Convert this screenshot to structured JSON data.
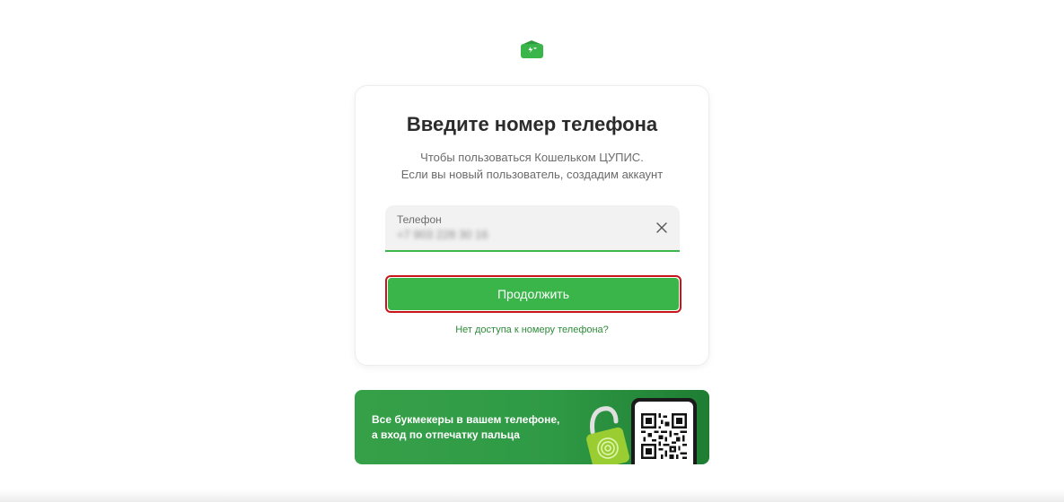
{
  "card": {
    "title": "Введите номер телефона",
    "subtitle_line1": "Чтобы пользоваться Кошельком ЦУПИС.",
    "subtitle_line2": "Если вы новый пользователь, создадим аккаунт",
    "phone_label": "Телефон",
    "phone_value": "+7 903 228 30 16",
    "continue_label": "Продолжить",
    "no_access_link": "Нет доступа к номеру телефона?"
  },
  "banner": {
    "line1": "Все букмекеры в вашем телефоне,",
    "line2": "а вход по отпечатку пальца"
  },
  "colors": {
    "accent": "#3ab54a",
    "link": "#2e8b3a",
    "highlight_border": "#c8151b"
  },
  "icons": {
    "logo": "wallet-icon",
    "clear": "close-icon",
    "banner_lock": "padlock-fingerprint-icon",
    "qr": "qr-code-icon"
  }
}
